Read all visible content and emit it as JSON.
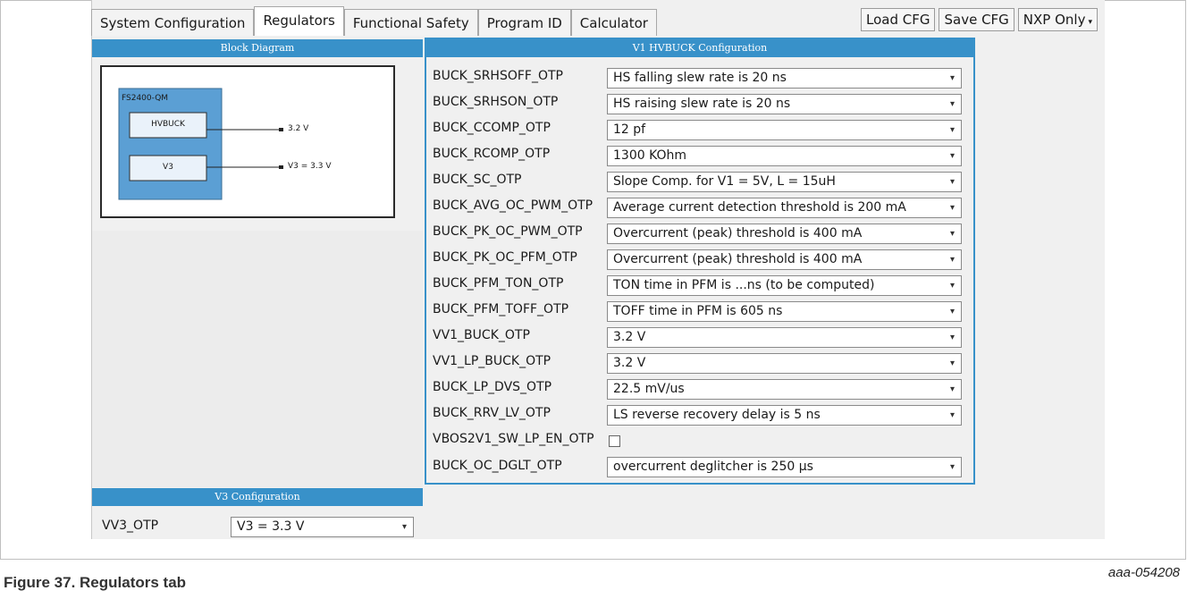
{
  "tabs": [
    {
      "label": "System Configuration"
    },
    {
      "label": "Regulators"
    },
    {
      "label": "Functional Safety"
    },
    {
      "label": "Program ID"
    },
    {
      "label": "Calculator"
    }
  ],
  "active_tab": "Regulators",
  "toolbar": {
    "load": "Load CFG",
    "save": "Save CFG",
    "nxp": "NXP Only"
  },
  "block_diagram": {
    "title": "Block Diagram",
    "device": "FS2400-QM",
    "blocks": [
      {
        "label": "HVBUCK",
        "output": "3.2 V"
      },
      {
        "label": "V3",
        "output": "V3 = 3.3 V"
      }
    ]
  },
  "v1_config": {
    "title": "V1 HVBUCK Configuration",
    "rows": [
      {
        "label": "BUCK_SRHSOFF_OTP",
        "value": "HS falling slew rate is 20 ns"
      },
      {
        "label": "BUCK_SRHSON_OTP",
        "value": "HS raising slew rate is 20 ns"
      },
      {
        "label": "BUCK_CCOMP_OTP",
        "value": "12 pf"
      },
      {
        "label": "BUCK_RCOMP_OTP",
        "value": "1300 KOhm"
      },
      {
        "label": "BUCK_SC_OTP",
        "value": "Slope Comp. for V1 = 5V, L = 15uH"
      },
      {
        "label": "BUCK_AVG_OC_PWM_OTP",
        "value": "Average current detection threshold is 200 mA"
      },
      {
        "label": "BUCK_PK_OC_PWM_OTP",
        "value": "Overcurrent (peak) threshold is 400 mA"
      },
      {
        "label": "BUCK_PK_OC_PFM_OTP",
        "value": "Overcurrent (peak) threshold is 400 mA"
      },
      {
        "label": "BUCK_PFM_TON_OTP",
        "value": "TON time in PFM is ...ns (to be computed)"
      },
      {
        "label": "BUCK_PFM_TOFF_OTP",
        "value": "TOFF time in PFM is 605 ns"
      },
      {
        "label": "VV1_BUCK_OTP",
        "value": "3.2 V"
      },
      {
        "label": "VV1_LP_BUCK_OTP",
        "value": "3.2 V"
      },
      {
        "label": "BUCK_LP_DVS_OTP",
        "value": "22.5 mV/us"
      },
      {
        "label": "BUCK_RRV_LV_OTP",
        "value": "LS reverse recovery delay is 5 ns"
      }
    ],
    "checkbox_row": {
      "label": "VBOS2V1_SW_LP_EN_OTP",
      "checked": false
    },
    "last_row": {
      "label": "BUCK_OC_DGLT_OTP",
      "value": "overcurrent deglitcher is 250 µs"
    }
  },
  "v3_config": {
    "title": "V3 Configuration",
    "label": "VV3_OTP",
    "value": "V3 = 3.3 V"
  },
  "figure_id": "aaa-054208",
  "caption": "Figure 37.  Regulators tab",
  "colors": {
    "header": "#3891c9",
    "block_fill": "#5b9fd4",
    "panel_bg": "#f0f0f0"
  }
}
